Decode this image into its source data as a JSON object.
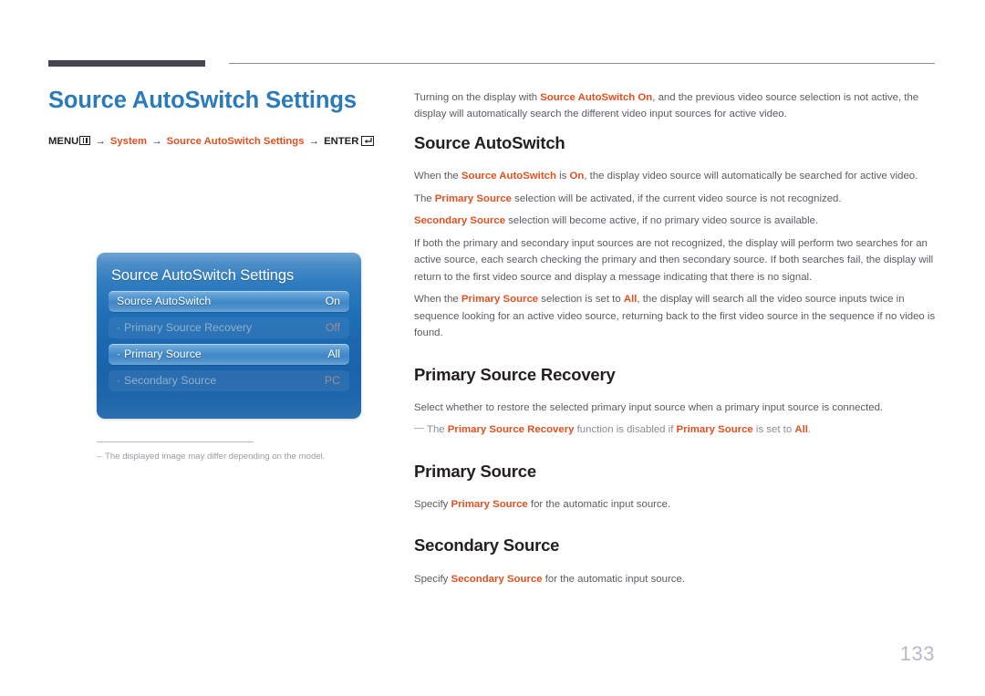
{
  "page_title": "Source AutoSwitch Settings",
  "menu_path": {
    "root_label": "MENU",
    "menu_icon": "menu-grid-icon",
    "crumb1": "System",
    "crumb2": "Source AutoSwitch Settings",
    "enter_label": "ENTER",
    "enter_icon": "enter-return-icon",
    "arrow": "→"
  },
  "osd": {
    "title": "Source AutoSwitch Settings",
    "rows": [
      {
        "bullet": "",
        "label": "Source AutoSwitch",
        "value": "On",
        "state": "active"
      },
      {
        "bullet": "·",
        "label": "Primary Source Recovery",
        "value": "Off",
        "state": "dim"
      },
      {
        "bullet": "·",
        "label": "Primary Source",
        "value": "All",
        "state": "active"
      },
      {
        "bullet": "·",
        "label": "Secondary Source",
        "value": "PC",
        "state": "dim"
      }
    ]
  },
  "left_note": {
    "dash": "–",
    "text": "The displayed image may differ depending on the model."
  },
  "intro": {
    "part1": "Turning on the display with ",
    "hl1": "Source AutoSwitch On",
    "part2": ", and the previous video source selection is not active, the display will automatically search the different video input sources for active video."
  },
  "sections": [
    {
      "heading": "Source AutoSwitch",
      "paragraphs": [
        {
          "runs": [
            {
              "t": "When the ",
              "hl": false
            },
            {
              "t": "Source AutoSwitch",
              "hl": true
            },
            {
              "t": " is ",
              "hl": false
            },
            {
              "t": "On",
              "hl": true
            },
            {
              "t": ", the display video source will automatically be searched for active video.",
              "hl": false
            }
          ]
        },
        {
          "runs": [
            {
              "t": "The ",
              "hl": false
            },
            {
              "t": "Primary Source",
              "hl": true
            },
            {
              "t": " selection will be activated, if the current video source is not recognized.",
              "hl": false
            }
          ]
        },
        {
          "runs": [
            {
              "t": "Secondary Source",
              "hl": true
            },
            {
              "t": " selection will become active, if no primary video source is available.",
              "hl": false
            }
          ]
        },
        {
          "runs": [
            {
              "t": "If both the primary and secondary input sources are not recognized, the display will perform two searches for an active source, each search checking the primary and then secondary source. If both searches fail, the display will return to the first video source and display a message indicating that there is no signal.",
              "hl": false
            }
          ]
        },
        {
          "runs": [
            {
              "t": "When the ",
              "hl": false
            },
            {
              "t": "Primary Source",
              "hl": true
            },
            {
              "t": " selection is set to ",
              "hl": false
            },
            {
              "t": "All",
              "hl": true
            },
            {
              "t": ", the display will search all the video source inputs twice in sequence looking for an active video source, returning back to the first video source in the sequence if no video is found.",
              "hl": false
            }
          ]
        }
      ]
    },
    {
      "heading": "Primary Source Recovery",
      "paragraphs": [
        {
          "runs": [
            {
              "t": "Select whether to restore the selected primary input source when a primary input source is connected.",
              "hl": false
            }
          ]
        }
      ],
      "note": {
        "runs": [
          {
            "t": "The ",
            "hl": false
          },
          {
            "t": "Primary Source Recovery",
            "hl": true
          },
          {
            "t": " function is disabled if ",
            "hl": false
          },
          {
            "t": "Primary Source",
            "hl": true
          },
          {
            "t": " is set to ",
            "hl": false
          },
          {
            "t": "All",
            "hl": true
          },
          {
            "t": ".",
            "hl": false
          }
        ]
      }
    },
    {
      "heading": "Primary Source",
      "paragraphs": [
        {
          "runs": [
            {
              "t": "Specify ",
              "hl": false
            },
            {
              "t": "Primary Source",
              "hl": true
            },
            {
              "t": " for the automatic input source.",
              "hl": false
            }
          ]
        }
      ]
    },
    {
      "heading": "Secondary Source",
      "paragraphs": [
        {
          "runs": [
            {
              "t": "Specify ",
              "hl": false
            },
            {
              "t": "Secondary Source",
              "hl": true
            },
            {
              "t": " for the automatic input source.",
              "hl": false
            }
          ]
        }
      ]
    }
  ],
  "page_number": "133",
  "colors": {
    "title_blue": "#2b7ab9",
    "highlight_orange": "#e2501e",
    "body_gray": "#5b5b63",
    "heading_black": "#231f20",
    "rule_dark": "#454552",
    "page_number_gray": "#b8b8c8"
  }
}
